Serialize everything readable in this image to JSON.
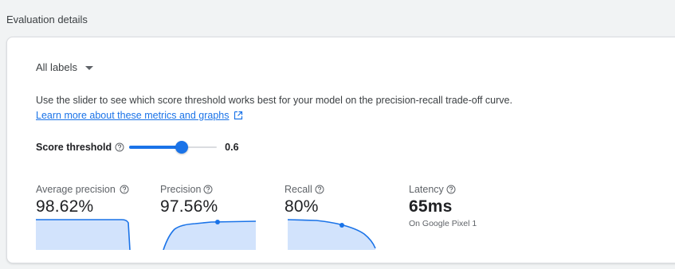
{
  "section": {
    "title": "Evaluation details"
  },
  "labels_select": {
    "value": "All labels"
  },
  "description": "Use the slider to see which score threshold works best for your model on the precision-recall trade-off curve.",
  "learn_more": "Learn more about these metrics and graphs",
  "threshold": {
    "label": "Score threshold",
    "value": 0.6,
    "value_text": "0.6"
  },
  "metrics": {
    "average_precision": {
      "label": "Average precision",
      "value": "98.62%"
    },
    "precision": {
      "label": "Precision",
      "value": "97.56%"
    },
    "recall": {
      "label": "Recall",
      "value": "80%"
    },
    "latency": {
      "label": "Latency",
      "value": "65ms",
      "sub": "On Google Pixel 1"
    }
  },
  "colors": {
    "accent": "#1a73e8",
    "area_fill": "#d2e3fc",
    "background": "#f1f3f4"
  },
  "icons": {
    "dropdown": "caret-down-icon",
    "external": "open-in-new-icon",
    "help": "help-circle-icon"
  }
}
